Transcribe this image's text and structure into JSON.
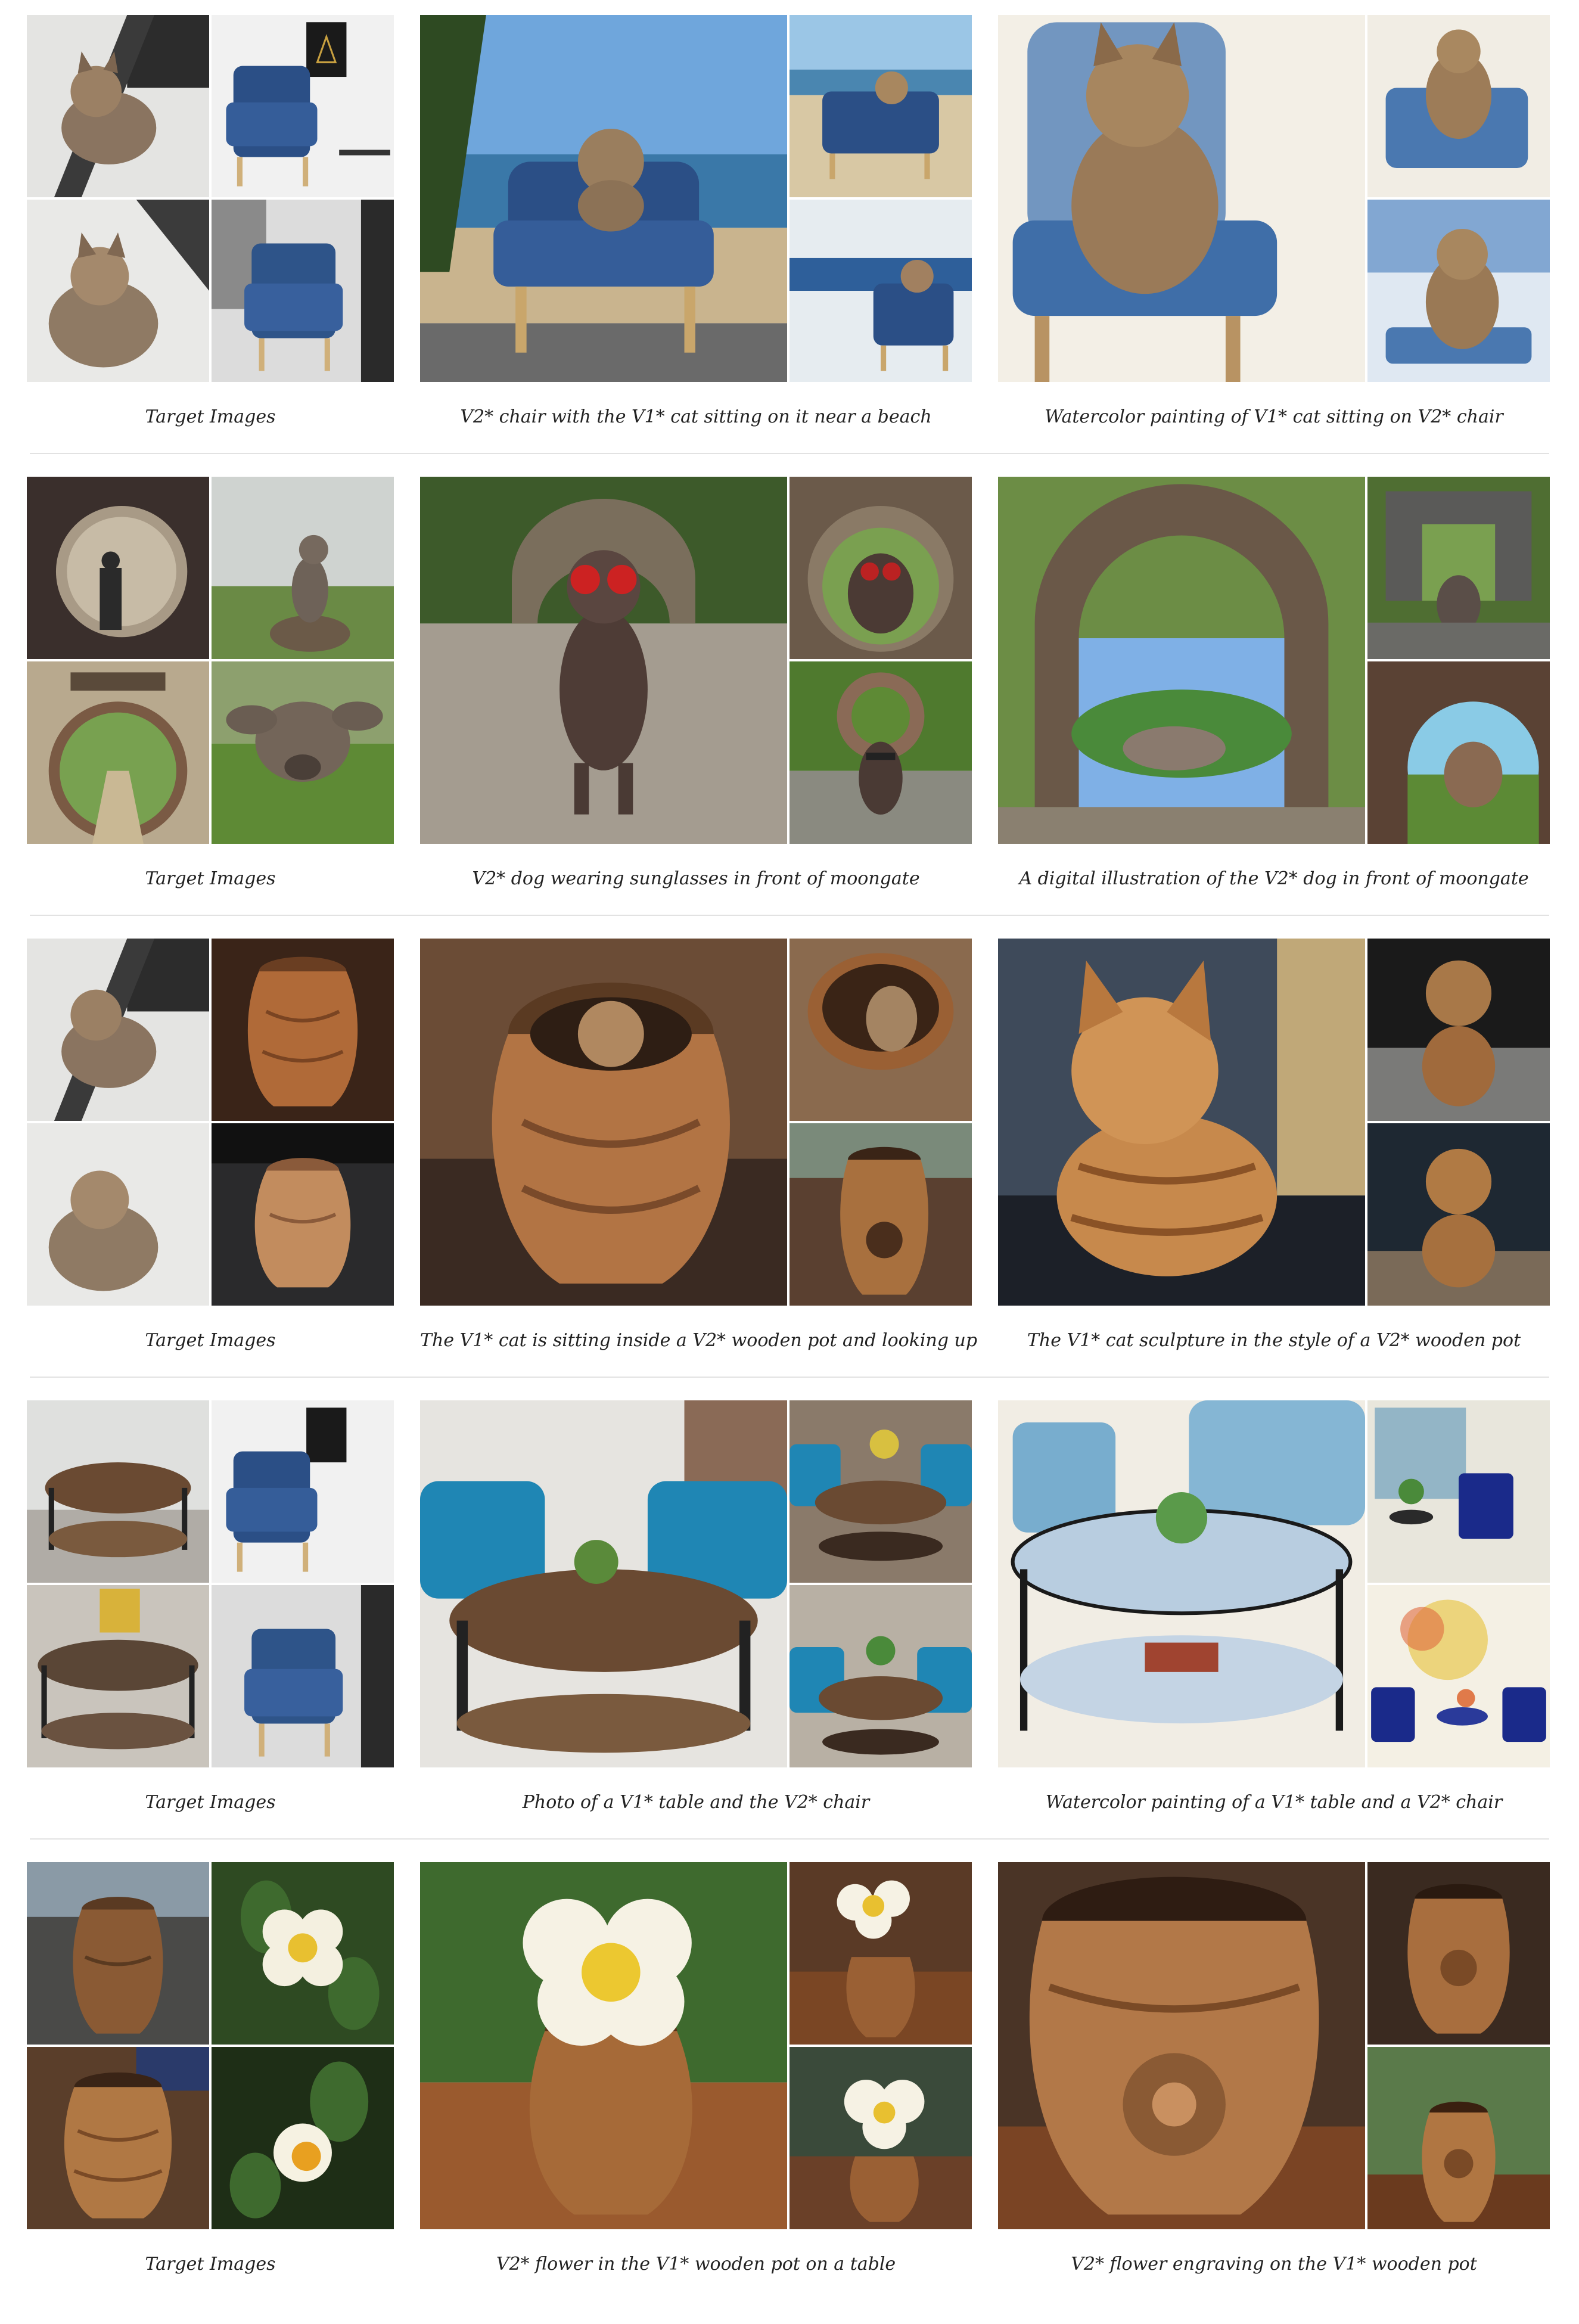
{
  "rows": [
    {
      "target_caption": "Target Images",
      "gen1_caption": "V2* chair with the V1* cat sitting on it near a beach",
      "gen2_caption": "Watercolor painting of V1* cat sitting on V2* chair"
    },
    {
      "target_caption": "Target Images",
      "gen1_caption": "V2* dog wearing sunglasses in front of moongate",
      "gen2_caption": "A digital illustration of the V2* dog in front of moongate"
    },
    {
      "target_caption": "Target Images",
      "gen1_caption": "The V1* cat is sitting inside a V2* wooden pot and looking up",
      "gen2_caption": "The V1* cat sculpture in the style of a V2* wooden pot"
    },
    {
      "target_caption": "Target Images",
      "gen1_caption": "Photo of a V1* table and the V2* chair",
      "gen2_caption": "Watercolor painting of a V1* table and a V2* chair"
    },
    {
      "target_caption": "Target Images",
      "gen1_caption": "V2* flower in the V1* wooden pot on a table",
      "gen2_caption": "V2* flower engraving on the V1* wooden pot"
    }
  ]
}
